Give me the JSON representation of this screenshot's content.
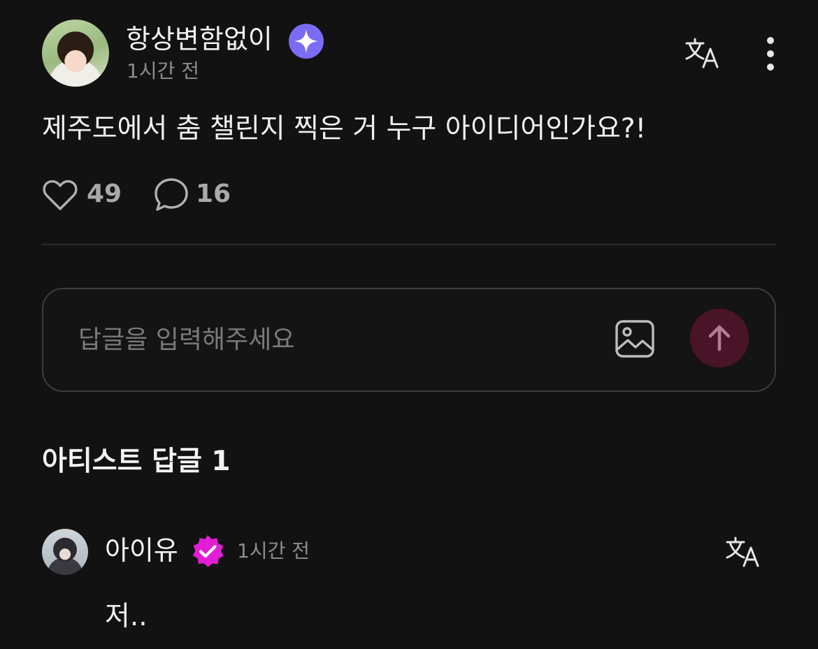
{
  "post": {
    "author": "항상변함없이",
    "author_badge_icon": "sparkle-badge-icon",
    "time": "1시간 전",
    "body": "제주도에서 춤 챌린지 찍은 거 누구 아이디어인가요?!",
    "likes": "49",
    "comments": "16",
    "like_icon": "heart-outline-icon",
    "comment_icon": "speech-bubble-icon",
    "translate_icon": "translate-icon",
    "more_icon": "more-vertical-icon"
  },
  "reply_input": {
    "placeholder": "답글을 입력해주세요",
    "image_icon": "image-icon",
    "send_icon": "arrow-up-icon"
  },
  "artist_replies": {
    "title": "아티스트 답글 1",
    "items": [
      {
        "author": "아이유",
        "badge_icon": "verified-badge-icon",
        "time": "1시간 전",
        "text": "저..",
        "translate_icon": "translate-icon"
      }
    ]
  },
  "colors": {
    "background": "#121212",
    "primary_text": "#f0f0f0",
    "secondary_text": "#8c8c8c",
    "sparkle_badge": "#7b6cf6",
    "verified_badge": "#e11dd5",
    "send_button": "#4a1428",
    "send_arrow": "#b67a96",
    "divider": "#2b2b2b"
  }
}
